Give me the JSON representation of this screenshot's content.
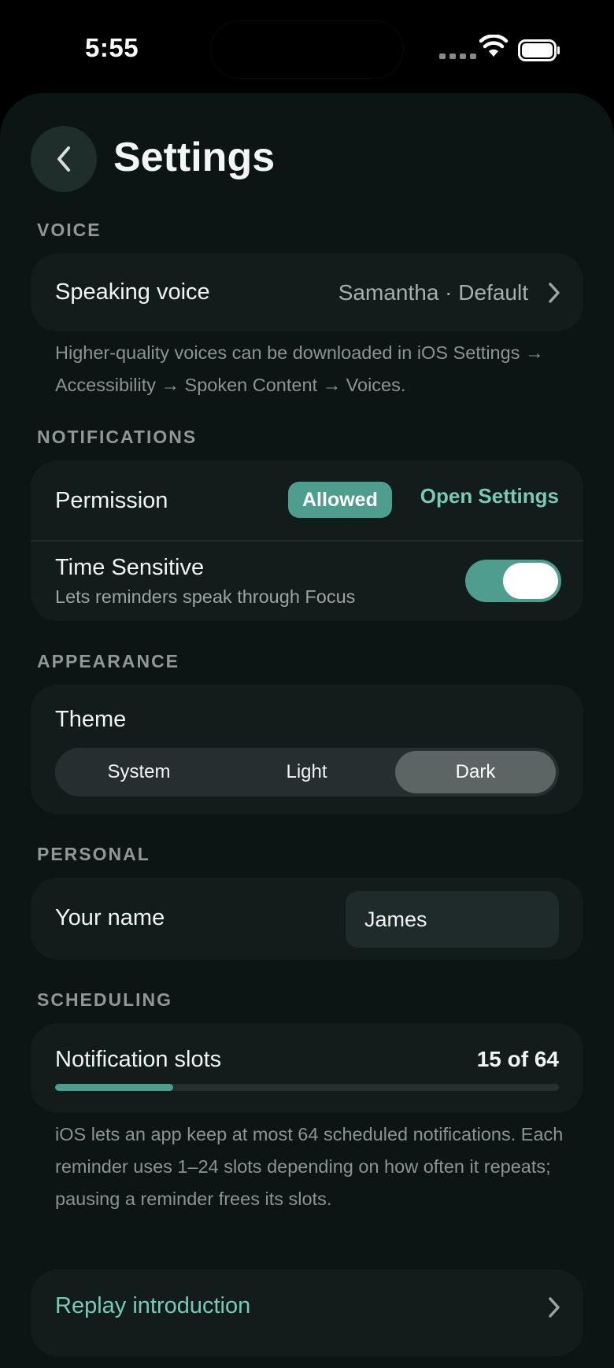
{
  "status_bar": {
    "time": "5:55"
  },
  "header": {
    "title": "Settings"
  },
  "voice": {
    "section": "VOICE",
    "label": "Speaking voice",
    "value": "Samantha · Default",
    "footnote": "Higher-quality voices can be downloaded in iOS Settings → Accessibility → Spoken Content → Voices."
  },
  "notifications": {
    "section": "NOTIFICATIONS",
    "permission_label": "Permission",
    "permission_badge": "Allowed",
    "open_settings": "Open Settings",
    "time_sensitive_label": "Time Sensitive",
    "time_sensitive_sub": "Lets reminders speak through Focus",
    "time_sensitive_on": true
  },
  "appearance": {
    "section": "APPEARANCE",
    "theme_label": "Theme",
    "options": [
      "System",
      "Light",
      "Dark"
    ],
    "selected": "Dark"
  },
  "personal": {
    "section": "PERSONAL",
    "name_label": "Your name",
    "name_value": "James"
  },
  "scheduling": {
    "section": "SCHEDULING",
    "slots_label": "Notification slots",
    "slots_count": "15 of 64",
    "slots_used": 15,
    "slots_total": 64,
    "footnote": "iOS lets an app keep at most 64 scheduled notifications. Each reminder uses 1–24 slots depending on how often it repeats; pausing a reminder frees its slots."
  },
  "replay": {
    "label": "Replay introduction"
  },
  "colors": {
    "accent": "#4f9d8f",
    "accent_text": "#79c9b6",
    "card": "#121c1b",
    "background": "#0b1514"
  },
  "icons": {
    "back": "chevron-left-icon",
    "disclosure": "chevron-right-icon"
  }
}
